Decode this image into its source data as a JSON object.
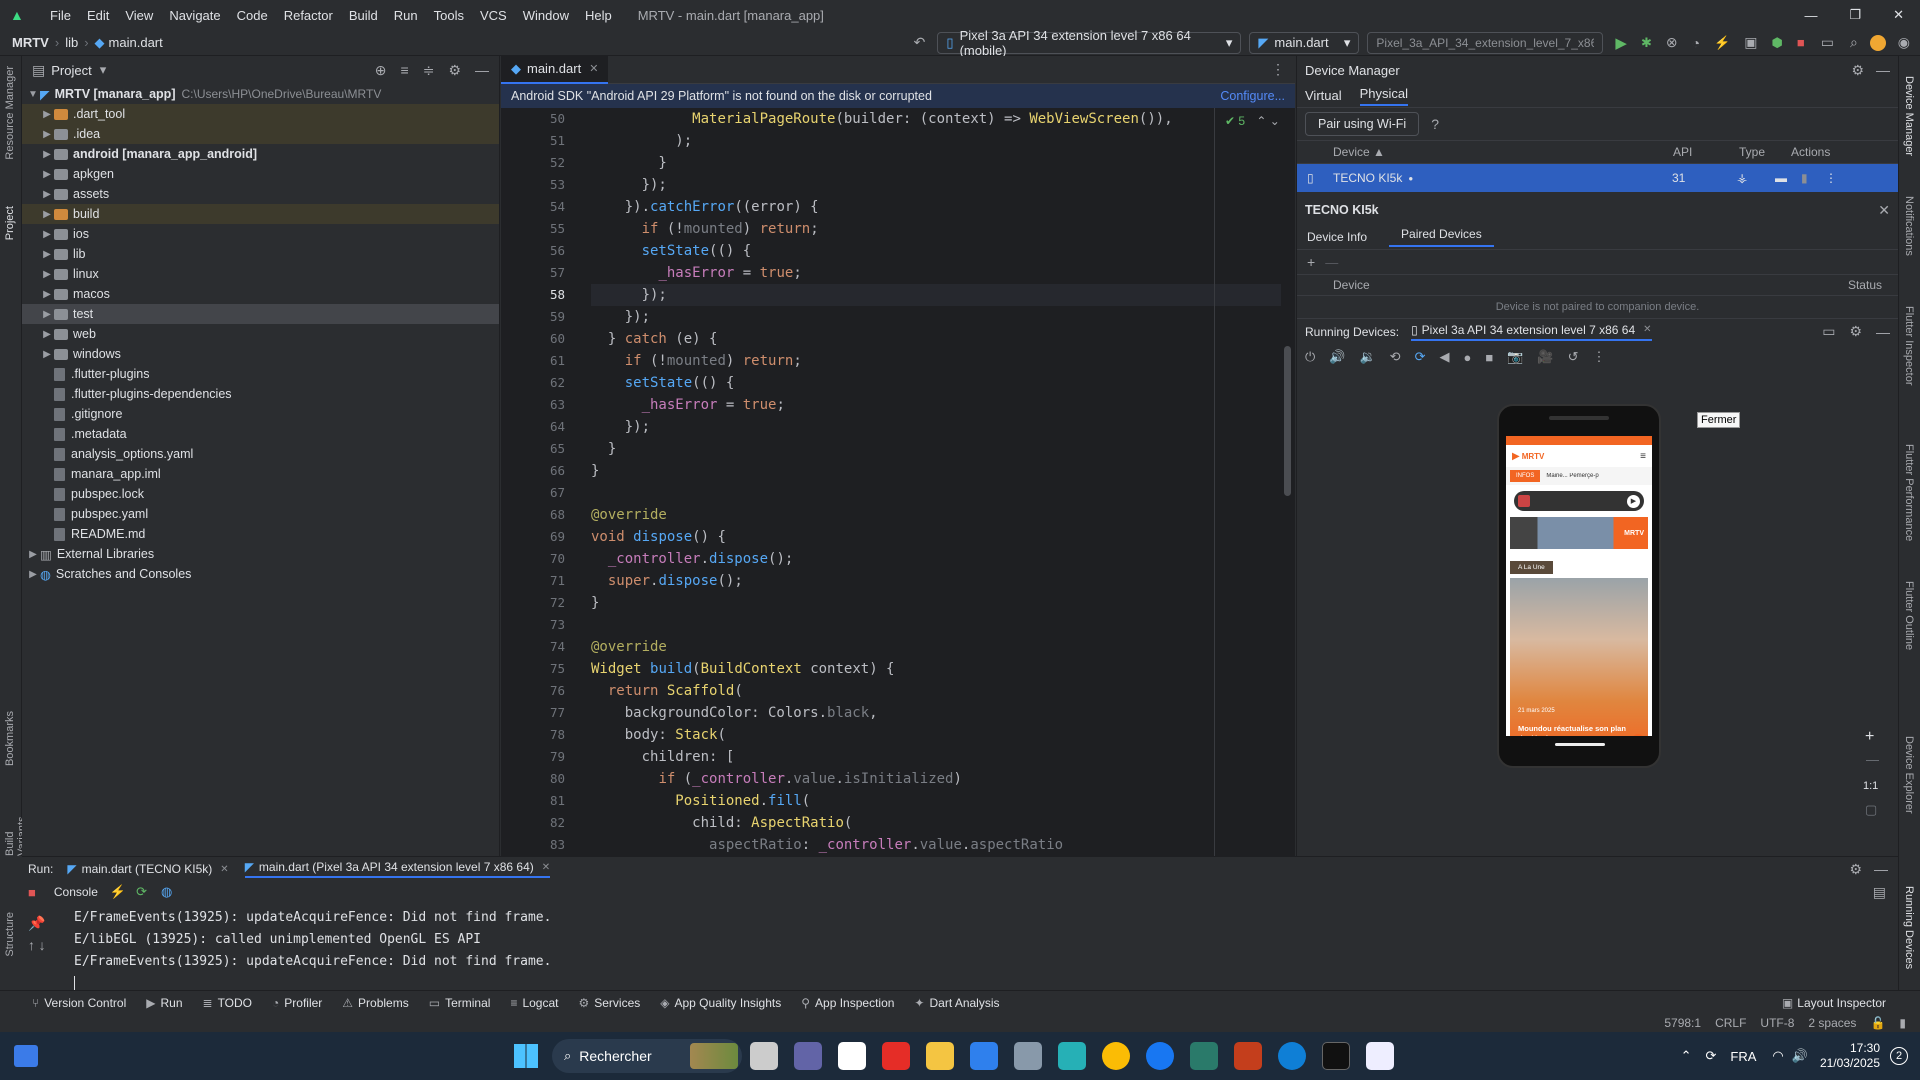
{
  "app": {
    "title": "MRTV - main.dart [manara_app]"
  },
  "menu": [
    "File",
    "Edit",
    "View",
    "Navigate",
    "Code",
    "Refactor",
    "Build",
    "Run",
    "Tools",
    "VCS",
    "Window",
    "Help"
  ],
  "breadcrumb": {
    "project": "MRTV",
    "dir": "lib",
    "file": "main.dart"
  },
  "toolbar": {
    "device_selector": "Pixel 3a API 34 extension level 7 x86 64 (mobile)",
    "run_config": "main.dart",
    "emulator_field": "Pixel_3a_API_34_extension_level_7_x86..."
  },
  "project_panel": {
    "title": "Project",
    "root": "MRTV [manara_app]",
    "root_path": "C:\\Users\\HP\\OneDrive\\Bureau\\MRTV",
    "items": [
      {
        "label": ".dart_tool",
        "type": "folder",
        "color": "orange"
      },
      {
        "label": ".idea",
        "type": "folder",
        "color": "gray"
      },
      {
        "label": "android [manara_app_android]",
        "type": "folder",
        "color": "gray"
      },
      {
        "label": "apkgen",
        "type": "folder",
        "color": "gray"
      },
      {
        "label": "assets",
        "type": "folder",
        "color": "gray"
      },
      {
        "label": "build",
        "type": "folder",
        "color": "orange"
      },
      {
        "label": "ios",
        "type": "folder",
        "color": "gray"
      },
      {
        "label": "lib",
        "type": "folder",
        "color": "gray"
      },
      {
        "label": "linux",
        "type": "folder",
        "color": "gray"
      },
      {
        "label": "macos",
        "type": "folder",
        "color": "gray"
      },
      {
        "label": "test",
        "type": "folder",
        "color": "gray"
      },
      {
        "label": "web",
        "type": "folder",
        "color": "gray"
      },
      {
        "label": "windows",
        "type": "folder",
        "color": "gray"
      },
      {
        "label": ".flutter-plugins",
        "type": "file"
      },
      {
        "label": ".flutter-plugins-dependencies",
        "type": "file"
      },
      {
        "label": ".gitignore",
        "type": "file"
      },
      {
        "label": ".metadata",
        "type": "file"
      },
      {
        "label": "analysis_options.yaml",
        "type": "file"
      },
      {
        "label": "manara_app.iml",
        "type": "file"
      },
      {
        "label": "pubspec.lock",
        "type": "file"
      },
      {
        "label": "pubspec.yaml",
        "type": "file"
      },
      {
        "label": "README.md",
        "type": "file"
      }
    ],
    "external_libraries": "External Libraries",
    "scratches": "Scratches and Consoles"
  },
  "side_tools_left": [
    "Resource Manager",
    "Project",
    "Bookmarks",
    "Build Variants",
    "Structure"
  ],
  "side_tools_right": [
    "Device Manager",
    "Notifications",
    "Flutter Inspector",
    "Flutter Performance",
    "Flutter Outline",
    "Device Explorer",
    "Running Devices"
  ],
  "editor": {
    "tab": "main.dart",
    "banner": "Android SDK \"Android API 29 Platform\" is not found on the disk or corrupted",
    "banner_action": "Configure...",
    "checks": "5",
    "line_numbers": [
      "50",
      "51",
      "52",
      "53",
      "54",
      "55",
      "56",
      "57",
      "58",
      "59",
      "60",
      "61",
      "62",
      "63",
      "64",
      "65",
      "66",
      "67",
      "68",
      "69",
      "70",
      "71",
      "72",
      "73",
      "74",
      "75",
      "76",
      "77",
      "78",
      "79",
      "80",
      "81",
      "82",
      "83"
    ],
    "lines": [
      "            MaterialPageRoute(builder: (context) => WebViewScreen()),",
      "          );",
      "        }",
      "      });",
      "    }).catchError((error) {",
      "      if (!mounted) return;",
      "      setState(() {",
      "        _hasError = true;",
      "      });",
      "    });",
      "  } catch (e) {",
      "    if (!mounted) return;",
      "    setState(() {",
      "      _hasError = true;",
      "    });",
      "  }",
      "}",
      "",
      "@override",
      "void dispose() {",
      "  _controller.dispose();",
      "  super.dispose();",
      "}",
      "",
      "@override",
      "Widget build(BuildContext context) {",
      "  return Scaffold(",
      "    backgroundColor: Colors.black,",
      "    body: Stack(",
      "      children: [",
      "        if (_controller.value.isInitialized)",
      "          Positioned.fill(",
      "            child: AspectRatio(",
      "              aspectRatio: _controller.value.aspectRatio"
    ]
  },
  "device_manager": {
    "title": "Device Manager",
    "tabs": [
      "Virtual",
      "Physical"
    ],
    "pair_button": "Pair using Wi-Fi",
    "columns": [
      "Device",
      "API",
      "Type",
      "Actions"
    ],
    "device": {
      "name": "TECNO KI5k",
      "api": "31"
    },
    "detail_title": "TECNO KI5k",
    "detail_tabs": [
      "Device Info",
      "Paired Devices"
    ],
    "paired_columns": [
      "Device",
      "Status"
    ],
    "paired_empty": "Device is not paired to companion device."
  },
  "running_devices": {
    "label": "Running Devices:",
    "tab": "Pixel 3a API 34 extension level 7 x86 64",
    "tooltip": "Fermer",
    "zoom_ratio": "1:1",
    "phone": {
      "brand": "MRTV",
      "tab_active": "INFOS",
      "ticker": "Mairie... Pemerçe-p",
      "section": "A La Une",
      "badge_live": "MRTV",
      "headline": "Moundou réactualise son plan de développement",
      "date": "21 mars 2025"
    }
  },
  "run_panel": {
    "label": "Run:",
    "tabs": [
      "main.dart (TECNO KI5k)",
      "main.dart (Pixel 3a API 34 extension level 7 x86 64)"
    ],
    "console_label": "Console",
    "log": [
      "E/FrameEvents(13925): updateAcquireFence: Did not find frame.",
      "E/libEGL  (13925): called unimplemented OpenGL ES API",
      "E/FrameEvents(13925): updateAcquireFence: Did not find frame."
    ]
  },
  "bottom_tools": [
    "Version Control",
    "Run",
    "TODO",
    "Profiler",
    "Problems",
    "Terminal",
    "Logcat",
    "Services",
    "App Quality Insights",
    "App Inspection",
    "Dart Analysis"
  ],
  "layout_inspector": "Layout Inspector",
  "status": {
    "position": "5798:1",
    "line_sep": "CRLF",
    "encoding": "UTF-8",
    "indent": "2 spaces"
  },
  "taskbar": {
    "search": "Rechercher",
    "lang": "FRA",
    "time": "17:30",
    "date": "21/03/2025",
    "notif": "2"
  },
  "colors": {
    "accent": "#3574f0",
    "orange": "#f26522"
  }
}
